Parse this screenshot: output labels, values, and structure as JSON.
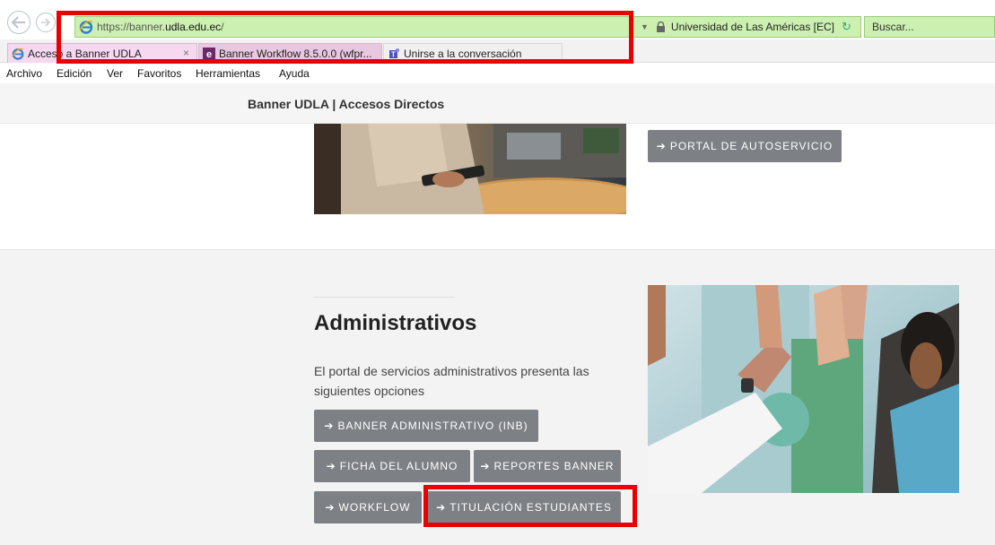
{
  "browser": {
    "url_prefix": "https://banner.",
    "url_domain": "udla.edu.ec",
    "url_suffix": "/",
    "site_identity": "Universidad de Las Américas [EC]",
    "search_placeholder": "Buscar...",
    "tabs": [
      {
        "label": "Acceso a Banner UDLA",
        "close": "×"
      },
      {
        "label": "Banner Workflow 8.5.0.0 (wfpr..."
      },
      {
        "label": "Unirse a la conversación"
      }
    ],
    "menu": [
      "Archivo",
      "Edición",
      "Ver",
      "Favoritos",
      "Herramientas",
      "Ayuda"
    ]
  },
  "page": {
    "header_title": "Banner UDLA | Accesos Directos",
    "top_section": {
      "button_label": "PORTAL DE AUTOSERVICIO"
    },
    "admin_section": {
      "title": "Administrativos",
      "description": "El portal de servicios administrativos presenta las siguientes opciones",
      "buttons": [
        "BANNER ADMINISTRATIVO (INB)",
        "FICHA DEL ALUMNO",
        "REPORTES BANNER",
        "WORKFLOW",
        "TITULACIÓN ESTUDIANTES"
      ]
    }
  },
  "colors": {
    "button_bg": "#7d8084",
    "highlight": "#ea0000",
    "address_bar": "#ccf0b0"
  }
}
